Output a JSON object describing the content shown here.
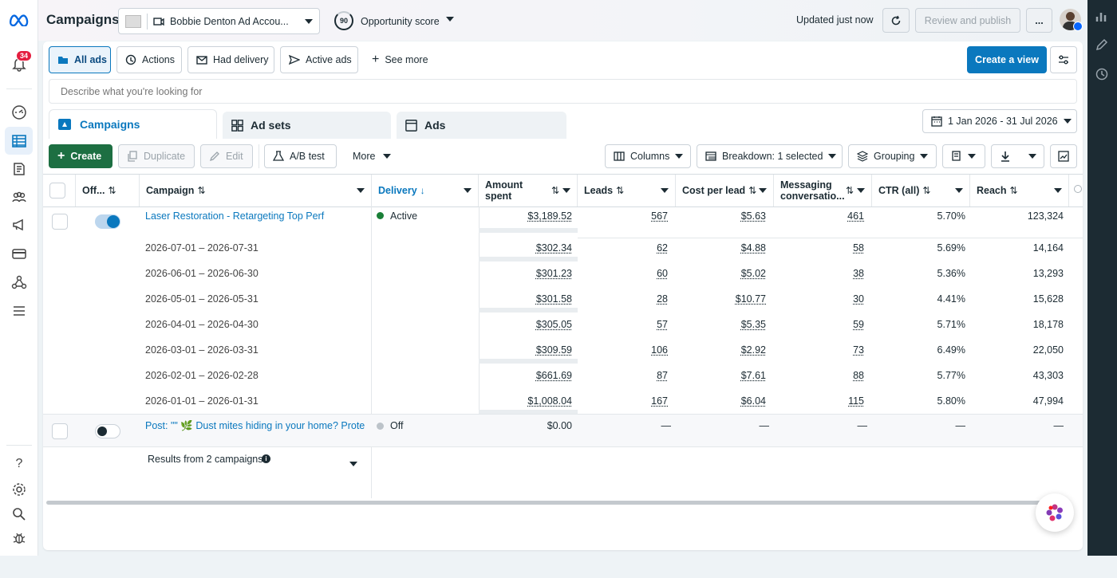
{
  "topbar": {
    "title": "Campaigns",
    "account_name": "Bobbie Denton Ad Accou...",
    "opportunity_score": "90",
    "opportunity_label": "Opportunity score",
    "updated": "Updated just now",
    "review_publish": "Review and publish",
    "more": "..."
  },
  "sidebar": {
    "notification_count": "34"
  },
  "filters": {
    "all_ads": "All ads",
    "actions": "Actions",
    "had_delivery": "Had delivery",
    "active_ads": "Active ads",
    "see_more": "See more",
    "create_view": "Create a view",
    "search_placeholder": "Describe what you're looking for"
  },
  "tabs": {
    "campaigns": "Campaigns",
    "ad_sets": "Ad sets",
    "ads": "Ads",
    "date_range": "1 Jan 2026 - 31 Jul 2026"
  },
  "toolbar": {
    "create": "Create",
    "duplicate": "Duplicate",
    "edit": "Edit",
    "ab_test": "A/B test",
    "more": "More",
    "columns": "Columns",
    "breakdown": "Breakdown: 1 selected",
    "grouping": "Grouping"
  },
  "table": {
    "headers": {
      "onoff": "Off...",
      "campaign": "Campaign",
      "delivery": "Delivery",
      "amount": "Amount spent",
      "leads": "Leads",
      "cpl": "Cost per lead",
      "messaging": "Messaging conversatio...",
      "ctr": "CTR (all)",
      "reach": "Reach"
    },
    "main_row": {
      "campaign": "Laser Restoration - Retargeting Top Perf",
      "delivery": "Active",
      "amount": "$3,189.52",
      "leads": "567",
      "cpl": "$5.63",
      "messaging": "461",
      "ctr": "5.70%",
      "reach": "123,324"
    },
    "breakdown_rows": [
      {
        "period": "2026-07-01 – 2026-07-31",
        "amount": "$302.34",
        "leads": "62",
        "cpl": "$4.88",
        "messaging": "58",
        "ctr": "5.69%",
        "reach": "14,164"
      },
      {
        "period": "2026-06-01 – 2026-06-30",
        "amount": "$301.23",
        "leads": "60",
        "cpl": "$5.02",
        "messaging": "38",
        "ctr": "5.36%",
        "reach": "13,293"
      },
      {
        "period": "2026-05-01 – 2026-05-31",
        "amount": "$301.58",
        "leads": "28",
        "cpl": "$10.77",
        "messaging": "30",
        "ctr": "4.41%",
        "reach": "15,628"
      },
      {
        "period": "2026-04-01 – 2026-04-30",
        "amount": "$305.05",
        "leads": "57",
        "cpl": "$5.35",
        "messaging": "59",
        "ctr": "5.71%",
        "reach": "18,178"
      },
      {
        "period": "2026-03-01 – 2026-03-31",
        "amount": "$309.59",
        "leads": "106",
        "cpl": "$2.92",
        "messaging": "73",
        "ctr": "6.49%",
        "reach": "22,050"
      },
      {
        "period": "2026-02-01 – 2026-02-28",
        "amount": "$661.69",
        "leads": "87",
        "cpl": "$7.61",
        "messaging": "88",
        "ctr": "5.77%",
        "reach": "43,303"
      },
      {
        "period": "2026-01-01 – 2026-01-31",
        "amount": "$1,008.04",
        "leads": "167",
        "cpl": "$6.04",
        "messaging": "115",
        "ctr": "5.80%",
        "reach": "47,994"
      }
    ],
    "second_row": {
      "campaign": "Post: \"\" 🌿 Dust mites hiding in your home? Prote...",
      "delivery": "Off",
      "amount": "$0.00",
      "leads": "—",
      "cpl": "—",
      "messaging": "—",
      "ctr": "—",
      "reach": "—"
    },
    "footer": "Results from 2 campaigns"
  },
  "colors": {
    "accent": "#0a78be",
    "create_green": "#1d6f42",
    "active_green": "#1a7f37"
  }
}
